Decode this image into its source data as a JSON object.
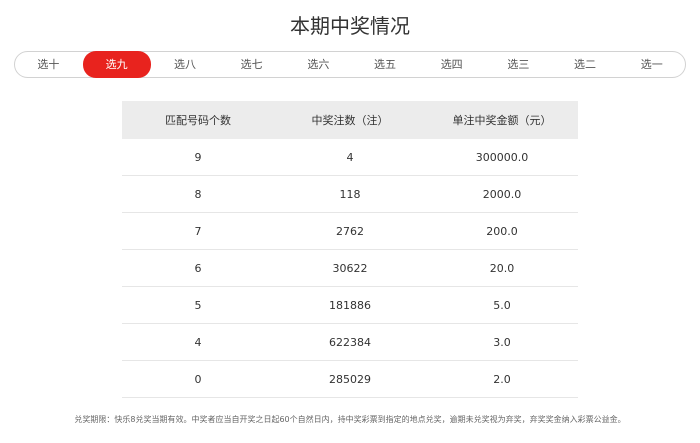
{
  "page": {
    "title": "本期中奖情况"
  },
  "tabs": [
    {
      "label": "选十",
      "active": false
    },
    {
      "label": "选九",
      "active": true
    },
    {
      "label": "选八",
      "active": false
    },
    {
      "label": "选七",
      "active": false
    },
    {
      "label": "选六",
      "active": false
    },
    {
      "label": "选五",
      "active": false
    },
    {
      "label": "选四",
      "active": false
    },
    {
      "label": "选三",
      "active": false
    },
    {
      "label": "选二",
      "active": false
    },
    {
      "label": "选一",
      "active": false
    }
  ],
  "table": {
    "headers": [
      "匹配号码个数",
      "中奖注数（注）",
      "单注中奖金额（元）"
    ],
    "rows": [
      [
        "9",
        "4",
        "300000.0"
      ],
      [
        "8",
        "118",
        "2000.0"
      ],
      [
        "7",
        "2762",
        "200.0"
      ],
      [
        "6",
        "30622",
        "20.0"
      ],
      [
        "5",
        "181886",
        "5.0"
      ],
      [
        "4",
        "622384",
        "3.0"
      ],
      [
        "0",
        "285029",
        "2.0"
      ]
    ]
  },
  "footnote": "兑奖期限：快乐8兑奖当期有效。中奖者应当自开奖之日起60个自然日内，持中奖彩票到指定的地点兑奖，逾期未兑奖视为弃奖，弃奖奖金纳入彩票公益金。",
  "colors": {
    "accent": "#e8231e",
    "header_bg": "#ececec",
    "border": "#d2d2d2"
  }
}
